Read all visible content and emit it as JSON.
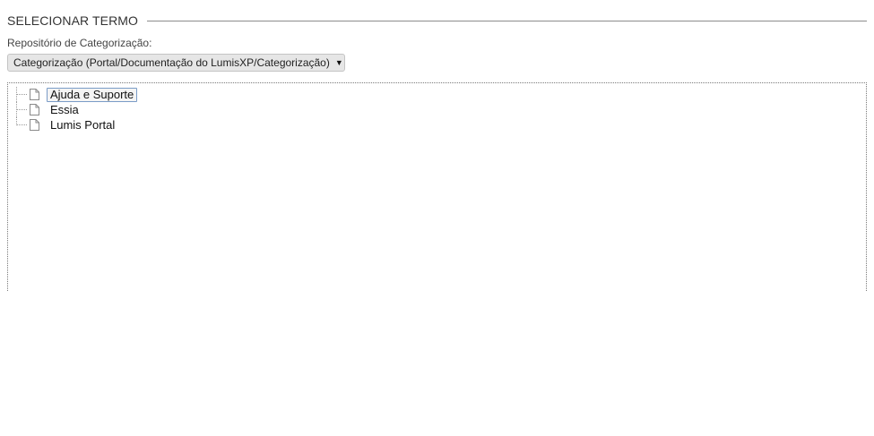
{
  "section": {
    "title": "SELECIONAR TERMO"
  },
  "repository": {
    "label": "Repositório de Categorização:",
    "selected_value": "Categorização (Portal/Documentação do LumisXP/Categorização)",
    "arrow_icon": "triangle-down-icon"
  },
  "tree": {
    "items": [
      {
        "label": "Ajuda e Suporte",
        "icon": "document-icon",
        "selected": true
      },
      {
        "label": "Essia",
        "icon": "document-icon",
        "selected": false
      },
      {
        "label": "Lumis Portal",
        "icon": "document-icon",
        "selected": false
      }
    ]
  },
  "colors": {
    "select_background": "#e6e6e6",
    "selection_border": "#7a9cc7"
  }
}
